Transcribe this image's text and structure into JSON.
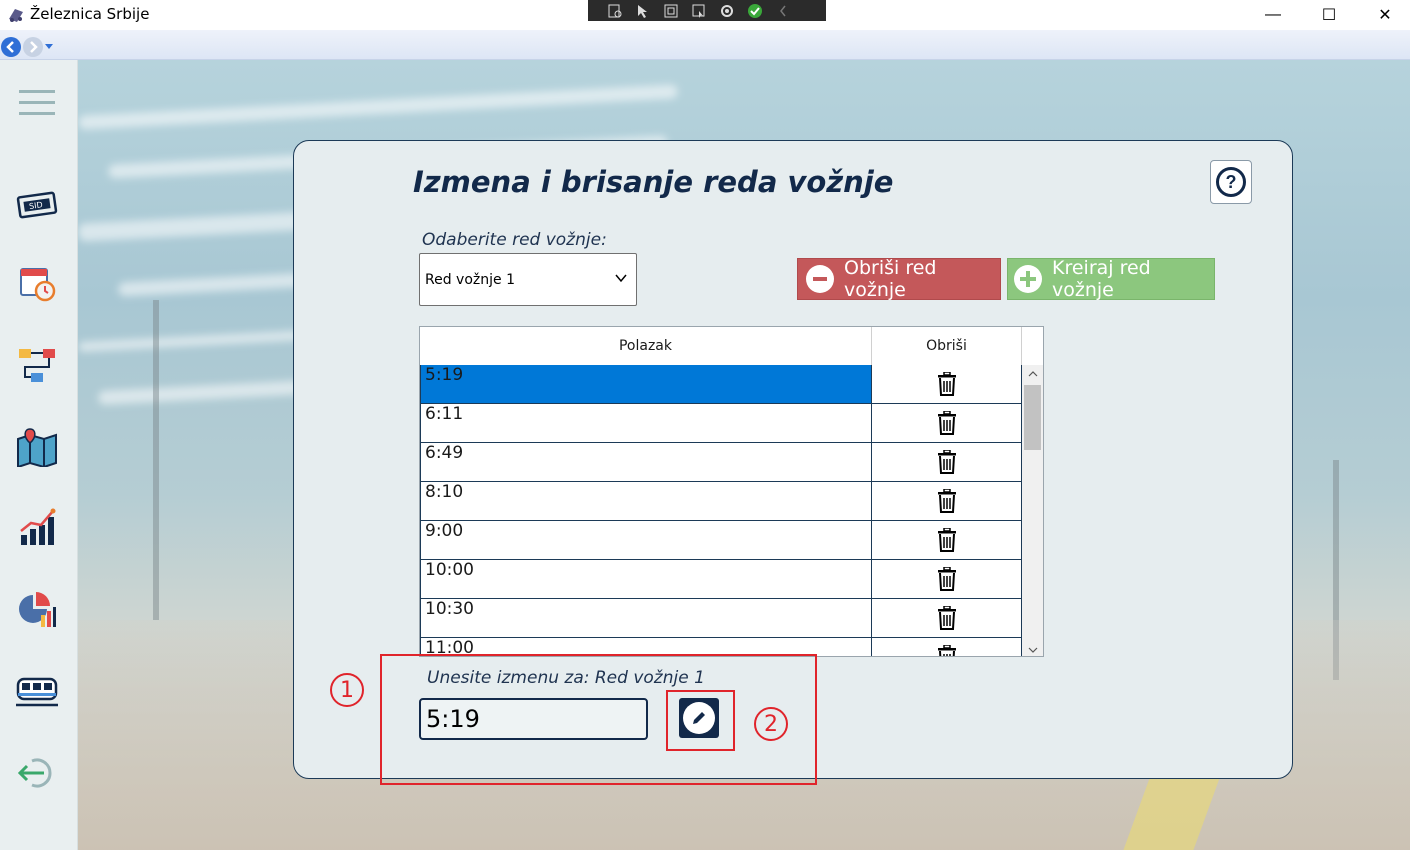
{
  "window": {
    "title": "Železnica Srbije",
    "minimize_glyph": "—",
    "maximize_glyph": "☐",
    "close_glyph": "✕"
  },
  "sidebar": {
    "items": [
      {
        "name": "menu-hamburger-icon"
      },
      {
        "name": "ticket-icon"
      },
      {
        "name": "calendar-clock-icon"
      },
      {
        "name": "route-icon"
      },
      {
        "name": "map-pin-icon"
      },
      {
        "name": "bar-chart-icon"
      },
      {
        "name": "pie-chart-icon"
      },
      {
        "name": "train-icon"
      },
      {
        "name": "logout-arrow-icon"
      }
    ]
  },
  "panel": {
    "title": "Izmena i brisanje reda vožnje",
    "help_label": "?",
    "select_label": "Odaberite red vožnje:",
    "selected_schedule": "Red vožnje 1",
    "delete_button": "Obriši red vožnje",
    "create_button": "Kreiraj red vožnje",
    "grid": {
      "columns": [
        "Polazak",
        "Obriši"
      ],
      "rows": [
        "5:19",
        "6:11",
        "6:49",
        "8:10",
        "9:00",
        "10:00",
        "10:30",
        "11:00"
      ],
      "selected_index": 0
    },
    "edit_label": "Unesite izmenu za: Red vožnje 1",
    "edit_value": "5:19"
  },
  "annotations": {
    "marker_1": "1",
    "marker_2": "2",
    "color": "#e0242b"
  },
  "colors": {
    "primary_dark": "#12294a",
    "delete_red": "#c4585a",
    "create_green": "#8cc77e",
    "selection_blue": "#0078d7"
  }
}
